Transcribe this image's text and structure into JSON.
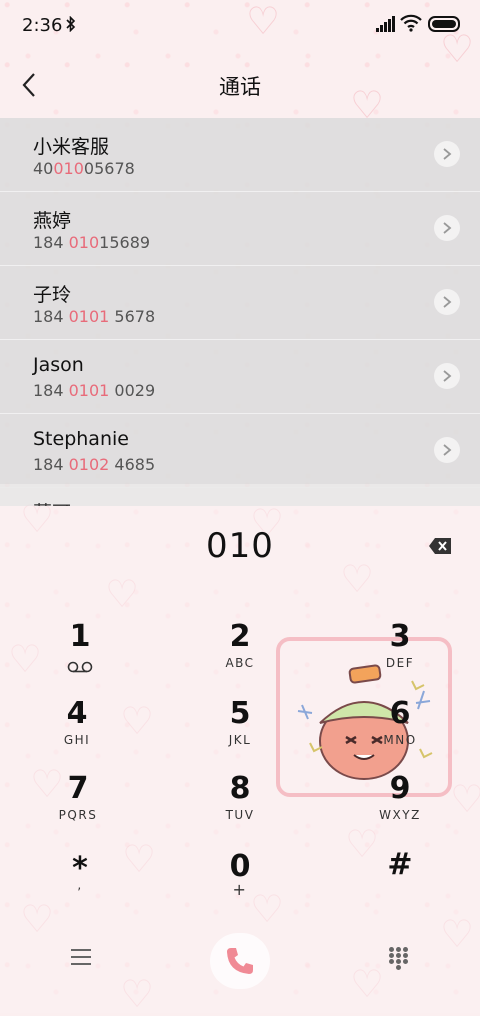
{
  "status_bar": {
    "time": "2:36",
    "bluetooth_icon": "bluetooth-icon",
    "signal_icon": "signal-icon",
    "wifi_icon": "wifi-icon",
    "battery_icon": "battery-icon"
  },
  "header": {
    "title": "通话",
    "back_icon": "back-arrow-icon"
  },
  "contacts": [
    {
      "name": "小米客服",
      "number_pre": "40",
      "number_match": "010",
      "number_post": "05678"
    },
    {
      "name": "燕婷",
      "number_pre": "184 ",
      "number_match": "010",
      "number_post": "15689"
    },
    {
      "name": "子玲",
      "number_pre": "184 ",
      "number_match": "0101",
      "number_post": " 5678"
    },
    {
      "name": "Jason",
      "number_pre": "184 ",
      "number_match": "0101",
      "number_post": " 0029"
    },
    {
      "name": "Stephanie",
      "number_pre": "184 ",
      "number_match": "0102",
      "number_post": " 4685"
    }
  ],
  "peek_contact": {
    "name": "莫可"
  },
  "dialer": {
    "input": "010",
    "backspace_icon": "backspace-icon",
    "keys": [
      {
        "digit": "1",
        "letters": "",
        "icon": "voicemail-icon"
      },
      {
        "digit": "2",
        "letters": "ABC"
      },
      {
        "digit": "3",
        "letters": "DEF"
      },
      {
        "digit": "4",
        "letters": "GHI"
      },
      {
        "digit": "5",
        "letters": "JKL"
      },
      {
        "digit": "6",
        "letters": "MNO"
      },
      {
        "digit": "7",
        "letters": "PQRS"
      },
      {
        "digit": "8",
        "letters": "TUV"
      },
      {
        "digit": "9",
        "letters": "WXYZ"
      },
      {
        "digit": "*",
        "letters": ","
      },
      {
        "digit": "0",
        "letters": "+"
      },
      {
        "digit": "#",
        "letters": ""
      }
    ]
  },
  "bottom_bar": {
    "menu_icon": "menu-icon",
    "call_icon": "phone-icon",
    "dialpad_icon": "dialpad-icon"
  },
  "colors": {
    "match_highlight": "#e86b7a",
    "call_accent": "#f08a95"
  }
}
